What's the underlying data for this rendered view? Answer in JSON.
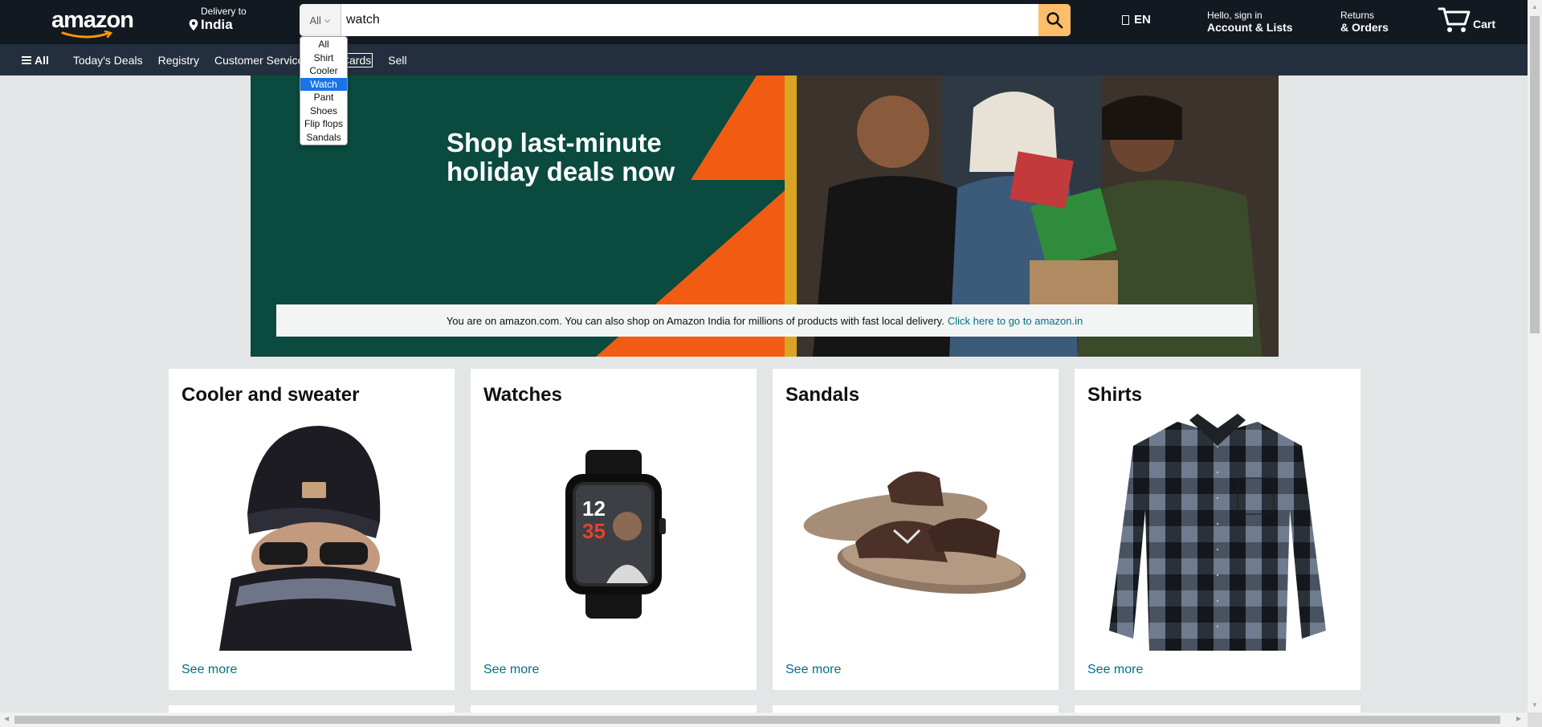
{
  "header": {
    "logo_text": "amazon",
    "deliver_line1": "Delivery to",
    "deliver_line2": "India",
    "search_category": "All",
    "search_value": "watch",
    "language": "EN",
    "account_line1": "Hello, sign in",
    "account_line2": "Account & Lists",
    "orders_line1": "Returns",
    "orders_line2": "& Orders",
    "cart_label": "Cart"
  },
  "dropdown": {
    "options": [
      "All",
      "Shirt",
      "Cooler",
      "Watch",
      "Pant",
      "Shoes",
      "Flip flops",
      "Sandals"
    ],
    "selected": "Watch"
  },
  "subnav": {
    "all_label": "All",
    "items": [
      "Today's Deals",
      "Registry",
      "Customer Service",
      "Gift Cards",
      "Sell"
    ]
  },
  "hero": {
    "title_line1": "Shop last-minute",
    "title_line2": "holiday deals now",
    "banner_text": "You are on amazon.com. You can also shop on Amazon India for millions of products with fast local delivery.",
    "banner_link": "Click here to go to amazon.in"
  },
  "cards": [
    {
      "title": "Cooler and sweater",
      "link": "See more",
      "image": "beanie-icon"
    },
    {
      "title": "Watches",
      "link": "See more",
      "image": "smartwatch-icon"
    },
    {
      "title": "Sandals",
      "link": "See more",
      "image": "sandals-icon"
    },
    {
      "title": "Shirts",
      "link": "See more",
      "image": "shirt-icon"
    }
  ],
  "colors": {
    "header_bg": "#131921",
    "subnav_bg": "#232f3e",
    "search_button": "#febd69",
    "link": "#007185",
    "page_bg": "#e3e6e6",
    "hero_green": "#0a4a3f",
    "hero_orange": "#f25c12"
  }
}
